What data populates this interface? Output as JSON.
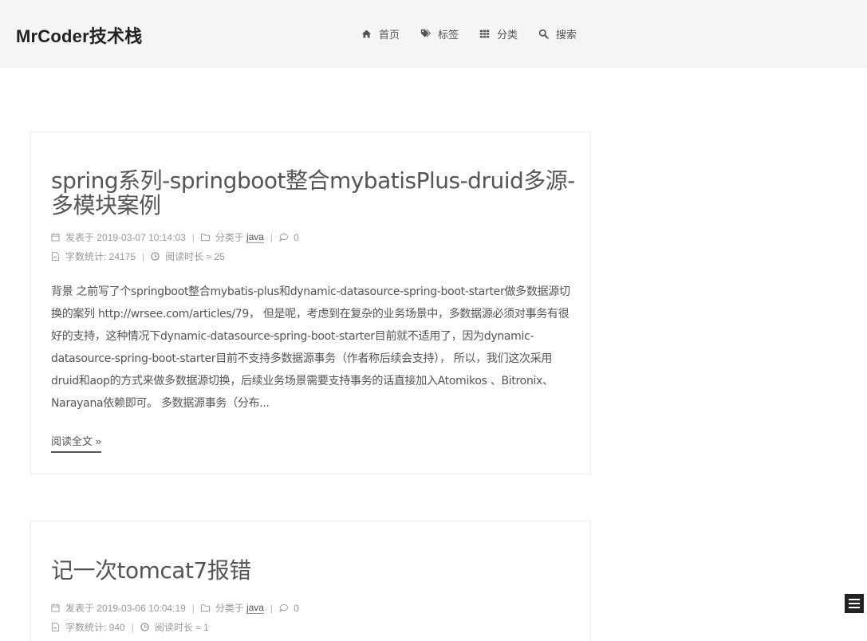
{
  "header": {
    "brand": "MrCoder技术栈",
    "nav": [
      {
        "label": "首页",
        "icon": "home-icon"
      },
      {
        "label": "标签",
        "icon": "tags-icon"
      },
      {
        "label": "分类",
        "icon": "th-icon"
      },
      {
        "label": "搜索",
        "icon": "search-icon"
      }
    ]
  },
  "posts": [
    {
      "title": "spring系列-springboot整合mybatisPlus-druid多源-多模块案例",
      "posted_prefix": "发表于",
      "posted": "2019-03-07 10:14:03",
      "category_prefix": "分类于",
      "category": "java",
      "comments": "0",
      "wordcount": "字数统计: 24175",
      "readtime": "阅读时长 ≈ 25",
      "excerpt": "背景 之前写了个springboot整合mybatis-plus和dynamic-datasource-spring-boot-starter做多数据源切换的案列 http://wrsee.com/articles/79，  但是呢，考虑到在复杂的业务场景中，多数据源必须对事务有很好的支持，这种情况下dynamic-datasource-spring-boot-starter目前就不适用了，因为dynamic-datasource-spring-boot-starter目前不支持多数据源事务（作者称后续会支持），  所以，我们这次采用druid和aop的方式来做多数据源切换，后续业务场景需要支持事务的话直接加入Atomikos 、Bitronix、Narayana依赖即可。 多数据源事务（分布...",
      "read_more": "阅读全文 »"
    },
    {
      "title": "记一次tomcat7报错",
      "posted_prefix": "发表于",
      "posted": "2019-03-06 10:04:19",
      "category_prefix": "分类于",
      "category": "java",
      "comments": "0",
      "wordcount": "字数统计: 940",
      "readtime": "阅读时长 ≈ 1"
    }
  ],
  "separator": "|",
  "colors": {
    "header_bg": "#f5f5f5",
    "text": "#555555",
    "meta": "#999999",
    "menu_toggle": "#222222"
  }
}
